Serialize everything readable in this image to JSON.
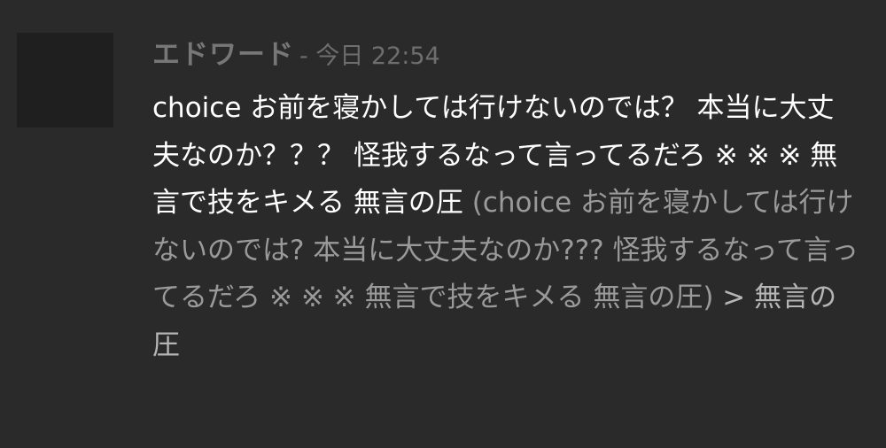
{
  "message": {
    "author": "エドワード",
    "timestamp": "- 今日 22:54",
    "text": "choice お前を寝かしては行けないのでは？ 本当に大丈夫なのか？？？ 怪我するなって言ってるだろ ※ ※ ※ 無言で技をキメる 無言の圧",
    "quoted_text": " (choice お前を寝かしては行けないのでは? 本当に大丈夫なのか??? 怪我するなって言ってるだろ ※ ※ ※ 無言で技をキメる 無言の圧)",
    "trailing_text": " > 無言の圧"
  }
}
